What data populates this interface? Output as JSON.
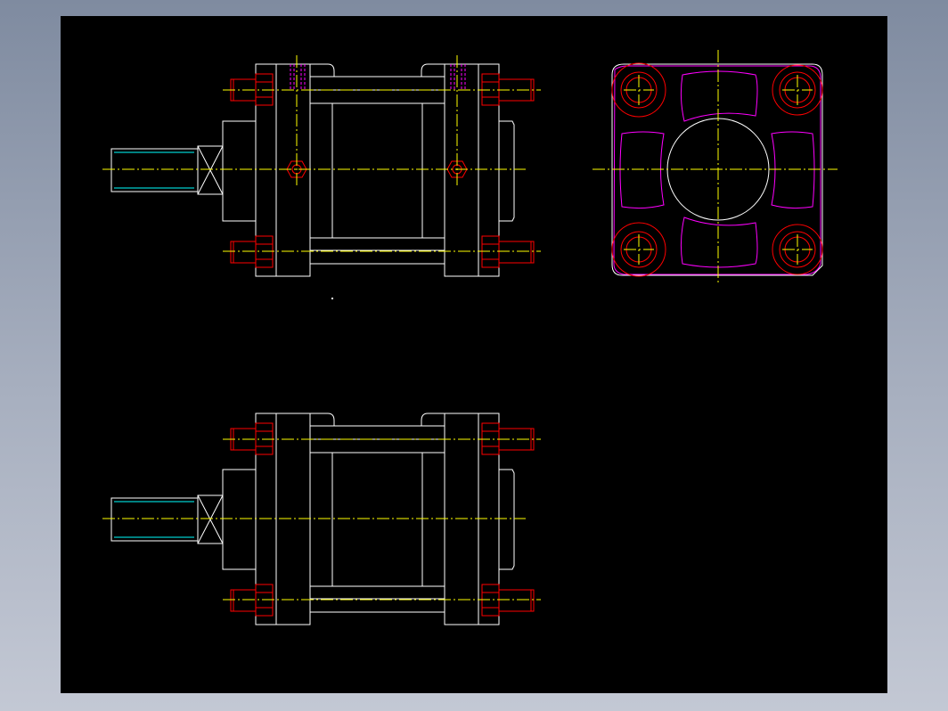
{
  "colors": {
    "background_outer": "#8a95a8",
    "canvas": "#000000",
    "outline": "#ffffff",
    "centerline": "#ffff00",
    "fastener": "#ff0000",
    "hidden_profile": "#ff00ff",
    "thread": "#00ffff"
  },
  "views": [
    {
      "id": "front-view",
      "type": "side elevation with rod, bolts and port holes"
    },
    {
      "id": "end-view",
      "type": "end cap with four bolts and bore"
    },
    {
      "id": "lower-view",
      "type": "side elevation without ports"
    }
  ]
}
